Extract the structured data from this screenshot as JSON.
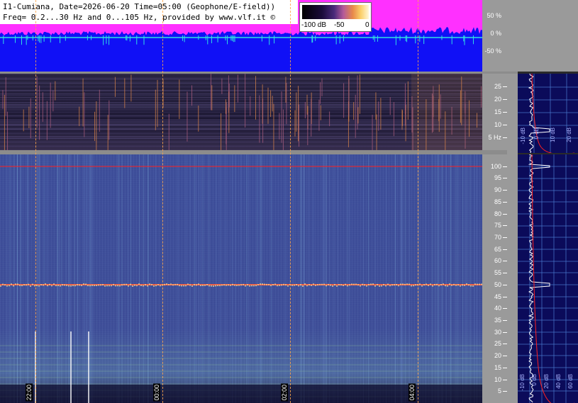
{
  "header": {
    "line1": "I1-Cumiana, Date=2026-06-20 Time=05:00 (Geophone/E-field))",
    "line2": "Freq= 0.2...30 Hz and 0...105 Hz, provided by www.vlf.it ©"
  },
  "colorbar": {
    "labels": [
      "-100 dB",
      "-50",
      "0"
    ]
  },
  "amp_axis": {
    "labels": [
      "50 %",
      "0 %",
      "-50 %"
    ]
  },
  "low_axis": {
    "labels": [
      "25",
      "20",
      "15",
      "10",
      "5 Hz"
    ]
  },
  "high_axis": {
    "labels": [
      "100",
      "95",
      "90",
      "85",
      "80",
      "75",
      "70",
      "65",
      "60",
      "55",
      "50",
      "45",
      "40",
      "35",
      "30",
      "25",
      "20",
      "15",
      "10",
      "5"
    ]
  },
  "profile_low_db": [
    "-10 dB",
    "0 dB",
    "10 dB",
    "20 dB"
  ],
  "profile_high_db": [
    "-10 dB",
    "0 dB",
    "20 dB",
    "40 dB",
    "60 dB"
  ],
  "time_labels": [
    "22:00",
    "00:00",
    "02:00",
    "04:00"
  ],
  "colors": {
    "amp_bg": "#1010f6",
    "amp_trace": "#ff30ff",
    "zero_line": "#30e0e0",
    "spectrum_line": "#ff2020",
    "marker": "#ffa64a"
  }
}
